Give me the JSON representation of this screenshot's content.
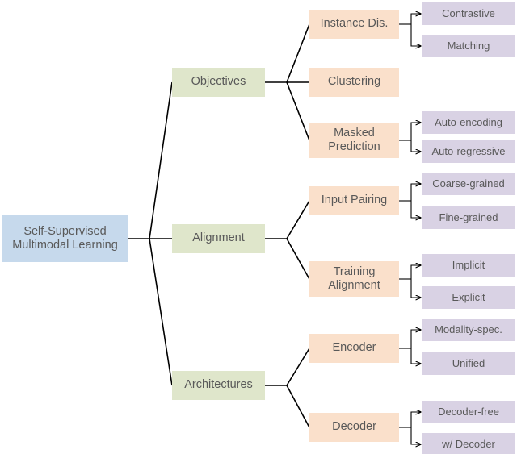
{
  "diagram": {
    "title": "Self-Supervised Multimodal Learning taxonomy",
    "colors": {
      "root": "#c6d9ec",
      "level1": "#dfe6cb",
      "level2": "#fae0cb",
      "leaf": "#d9d2e4",
      "edge": "#000000",
      "text": "#595959",
      "background": "#ffffff"
    },
    "root": {
      "label": "Self-Supervised\nMultimodal Learning"
    },
    "branches": [
      {
        "label": "Objectives",
        "children": [
          {
            "label": "Instance Dis.",
            "leaves": [
              {
                "label": "Contrastive"
              },
              {
                "label": "Matching"
              }
            ]
          },
          {
            "label": "Clustering",
            "leaves": []
          },
          {
            "label": "Masked\nPrediction",
            "leaves": [
              {
                "label": "Auto-encoding"
              },
              {
                "label": "Auto-regressive"
              }
            ]
          }
        ]
      },
      {
        "label": "Alignment",
        "children": [
          {
            "label": "Input Pairing",
            "leaves": [
              {
                "label": "Coarse-grained"
              },
              {
                "label": "Fine-grained"
              }
            ]
          },
          {
            "label": "Training\nAlignment",
            "leaves": [
              {
                "label": "Implicit"
              },
              {
                "label": "Explicit"
              }
            ]
          }
        ]
      },
      {
        "label": "Architectures",
        "children": [
          {
            "label": "Encoder",
            "leaves": [
              {
                "label": "Modality-spec."
              },
              {
                "label": "Unified"
              }
            ]
          },
          {
            "label": "Decoder",
            "leaves": [
              {
                "label": "Decoder-free"
              },
              {
                "label": "w/ Decoder"
              }
            ]
          }
        ]
      }
    ]
  }
}
